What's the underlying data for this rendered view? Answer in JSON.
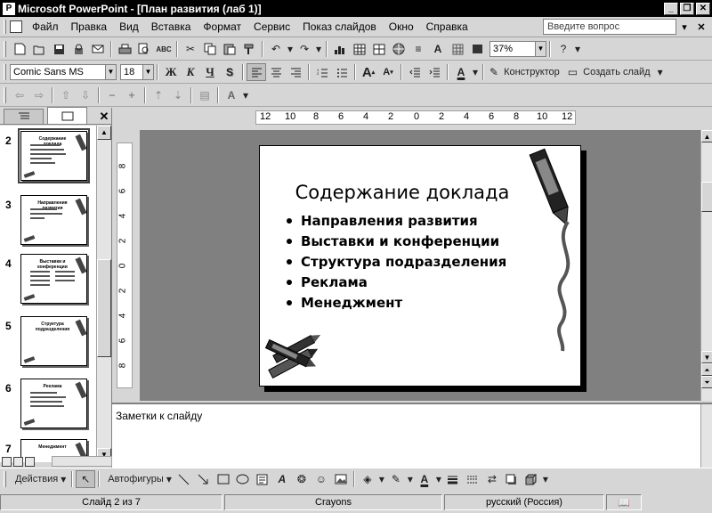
{
  "window": {
    "title": "Microsoft PowerPoint - [План развития (лаб 1)]",
    "app_icon": "P",
    "controls": [
      "_",
      "❐",
      "✕"
    ]
  },
  "menubar": {
    "items": [
      "Файл",
      "Правка",
      "Вид",
      "Вставка",
      "Формат",
      "Сервис",
      "Показ слайдов",
      "Окно",
      "Справка"
    ],
    "help_placeholder": "Введите вопрос",
    "close_glyph": "✕"
  },
  "standard_toolbar": {
    "zoom": "37%"
  },
  "formatting_toolbar": {
    "font": "Comic Sans MS",
    "size": "18",
    "bold": "Ж",
    "italic": "К",
    "underline": "Ч",
    "shadow": "S",
    "design_button": "Конструктор",
    "new_slide_button": "Создать слайд"
  },
  "slides_pane": {
    "close_glyph": "✕",
    "thumbnails": [
      {
        "number": "2",
        "title": "Содержание доклада",
        "selected": true
      },
      {
        "number": "3",
        "title": "Направления развития",
        "selected": false
      },
      {
        "number": "4",
        "title": "Выставки и конференции",
        "selected": false
      },
      {
        "number": "5",
        "title": "Структура подразделения",
        "selected": false
      },
      {
        "number": "6",
        "title": "Реклама",
        "selected": false
      },
      {
        "number": "7",
        "title": "Менеджмент",
        "selected": false
      }
    ]
  },
  "hruler": {
    "ticks": [
      "12",
      "10",
      "8",
      "6",
      "4",
      "2",
      "0",
      "2",
      "4",
      "6",
      "8",
      "10",
      "12"
    ]
  },
  "vruler": {
    "ticks": [
      "8",
      "6",
      "4",
      "2",
      "0",
      "2",
      "4",
      "6",
      "8"
    ]
  },
  "slide": {
    "title": "Содержание доклада",
    "bullets": [
      "Направления развития",
      "Выставки и конференции",
      "Структура подразделения",
      "Реклама",
      "Менеджмент"
    ]
  },
  "notes": {
    "placeholder": "Заметки к слайду"
  },
  "drawing_toolbar": {
    "actions": "Действия",
    "autoshapes": "Автофигуры"
  },
  "status": {
    "slide_info": "Слайд 2 из 7",
    "design": "Crayons",
    "language": "русский (Россия)"
  },
  "colors": {
    "title_bar": "#000000",
    "chrome": "#d6d6d6",
    "canvas": "#808080"
  }
}
